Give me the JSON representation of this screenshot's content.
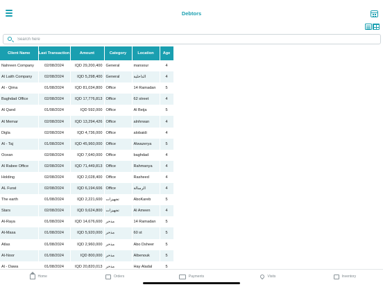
{
  "header": {
    "title": "Debtors",
    "menu_icon": "hamburger-menu-icon",
    "calendar_icon": "calendar-icon"
  },
  "view_toggle": {
    "list_icon": "list-view-icon",
    "grid_icon": "grid-view-icon"
  },
  "search": {
    "placeholder": "Search here",
    "value": ""
  },
  "table": {
    "columns": [
      "Client Name",
      "Last Transaction",
      "Amount",
      "Category",
      "Location",
      "Age"
    ],
    "rows": [
      [
        "Nahreen Company",
        "02/08/2024",
        "IQD 29,200,400",
        "General",
        "mansour",
        "4"
      ],
      [
        "Al Laith Company",
        "02/08/2024",
        "IQD 5,298,400",
        "General",
        "الداخلية",
        "4"
      ],
      [
        "Al - Qima",
        "01/08/2024",
        "IQD 81,034,800",
        "Office",
        "14 Ramadan",
        "5"
      ],
      [
        "Baghdad Office",
        "02/08/2024",
        "IQD 17,776,813",
        "Office",
        "62 street",
        "4"
      ],
      [
        "Al Qand",
        "01/08/2024",
        "IQD 592,000",
        "Office",
        "Al Beija",
        "5"
      ],
      [
        "Al Memar",
        "02/08/2024",
        "IQD 13,294,426",
        "Office",
        "alnhrwan",
        "4"
      ],
      [
        "Digla",
        "02/08/2024",
        "IQD 4,736,000",
        "Office",
        "alobaidi",
        "4"
      ],
      [
        "Al - Taj",
        "01/08/2024",
        "IQD 45,960,000",
        "Office",
        "Alwazerya",
        "5"
      ],
      [
        "Ocean",
        "02/08/2024",
        "IQD 7,640,000",
        "Office",
        "baghdad",
        "4"
      ],
      [
        "Al Rabee Office",
        "02/08/2024",
        "IQD 71,449,813",
        "Office",
        "Rahmanya",
        "4"
      ],
      [
        "Holding",
        "02/08/2024",
        "IQD 2,028,400",
        "Office",
        "Rasheed",
        "4"
      ],
      [
        "AL Furat",
        "02/08/2024",
        "IQD 6,194,606",
        "Office",
        "الرسالة",
        "4"
      ],
      [
        "The earth",
        "01/08/2024",
        "IQD 2,221,600",
        "تجهيزات",
        "AboKareb",
        "5"
      ],
      [
        "Stars",
        "02/08/2024",
        "IQD 9,624,800",
        "تجهيزات",
        "Al Ameen",
        "4"
      ],
      [
        "Al-Raya",
        "01/08/2024",
        "IQD 14,676,600",
        "مذخر",
        "14 Ramadan",
        "5"
      ],
      [
        "Al-Masa",
        "01/08/2024",
        "IQD 5,920,000",
        "مذخر",
        "60 st",
        "5"
      ],
      [
        "Atlas",
        "01/08/2024",
        "IQD 2,960,000",
        "مذخر",
        "Abo Dsheer",
        "5"
      ],
      [
        "Al-Noor",
        "01/08/2024",
        "IQD 800,000",
        "مذخر",
        "Albenouk",
        "5"
      ],
      [
        "Al - Dawa",
        "01/08/2024",
        "IQD 20,820,013",
        "مذخر",
        "Hay Aladal",
        "5"
      ]
    ]
  },
  "tabbar": {
    "items": [
      {
        "label": "Home",
        "icon": "home-icon"
      },
      {
        "label": "Orders",
        "icon": "orders-icon"
      },
      {
        "label": "Payments",
        "icon": "payments-card-icon"
      },
      {
        "label": "Visits",
        "icon": "location-pin-icon"
      },
      {
        "label": "Inventory",
        "icon": "inventory-boxes-icon"
      }
    ]
  },
  "colors": {
    "accent": "#1a9fb0",
    "row_alt": "#e9f4f6"
  }
}
